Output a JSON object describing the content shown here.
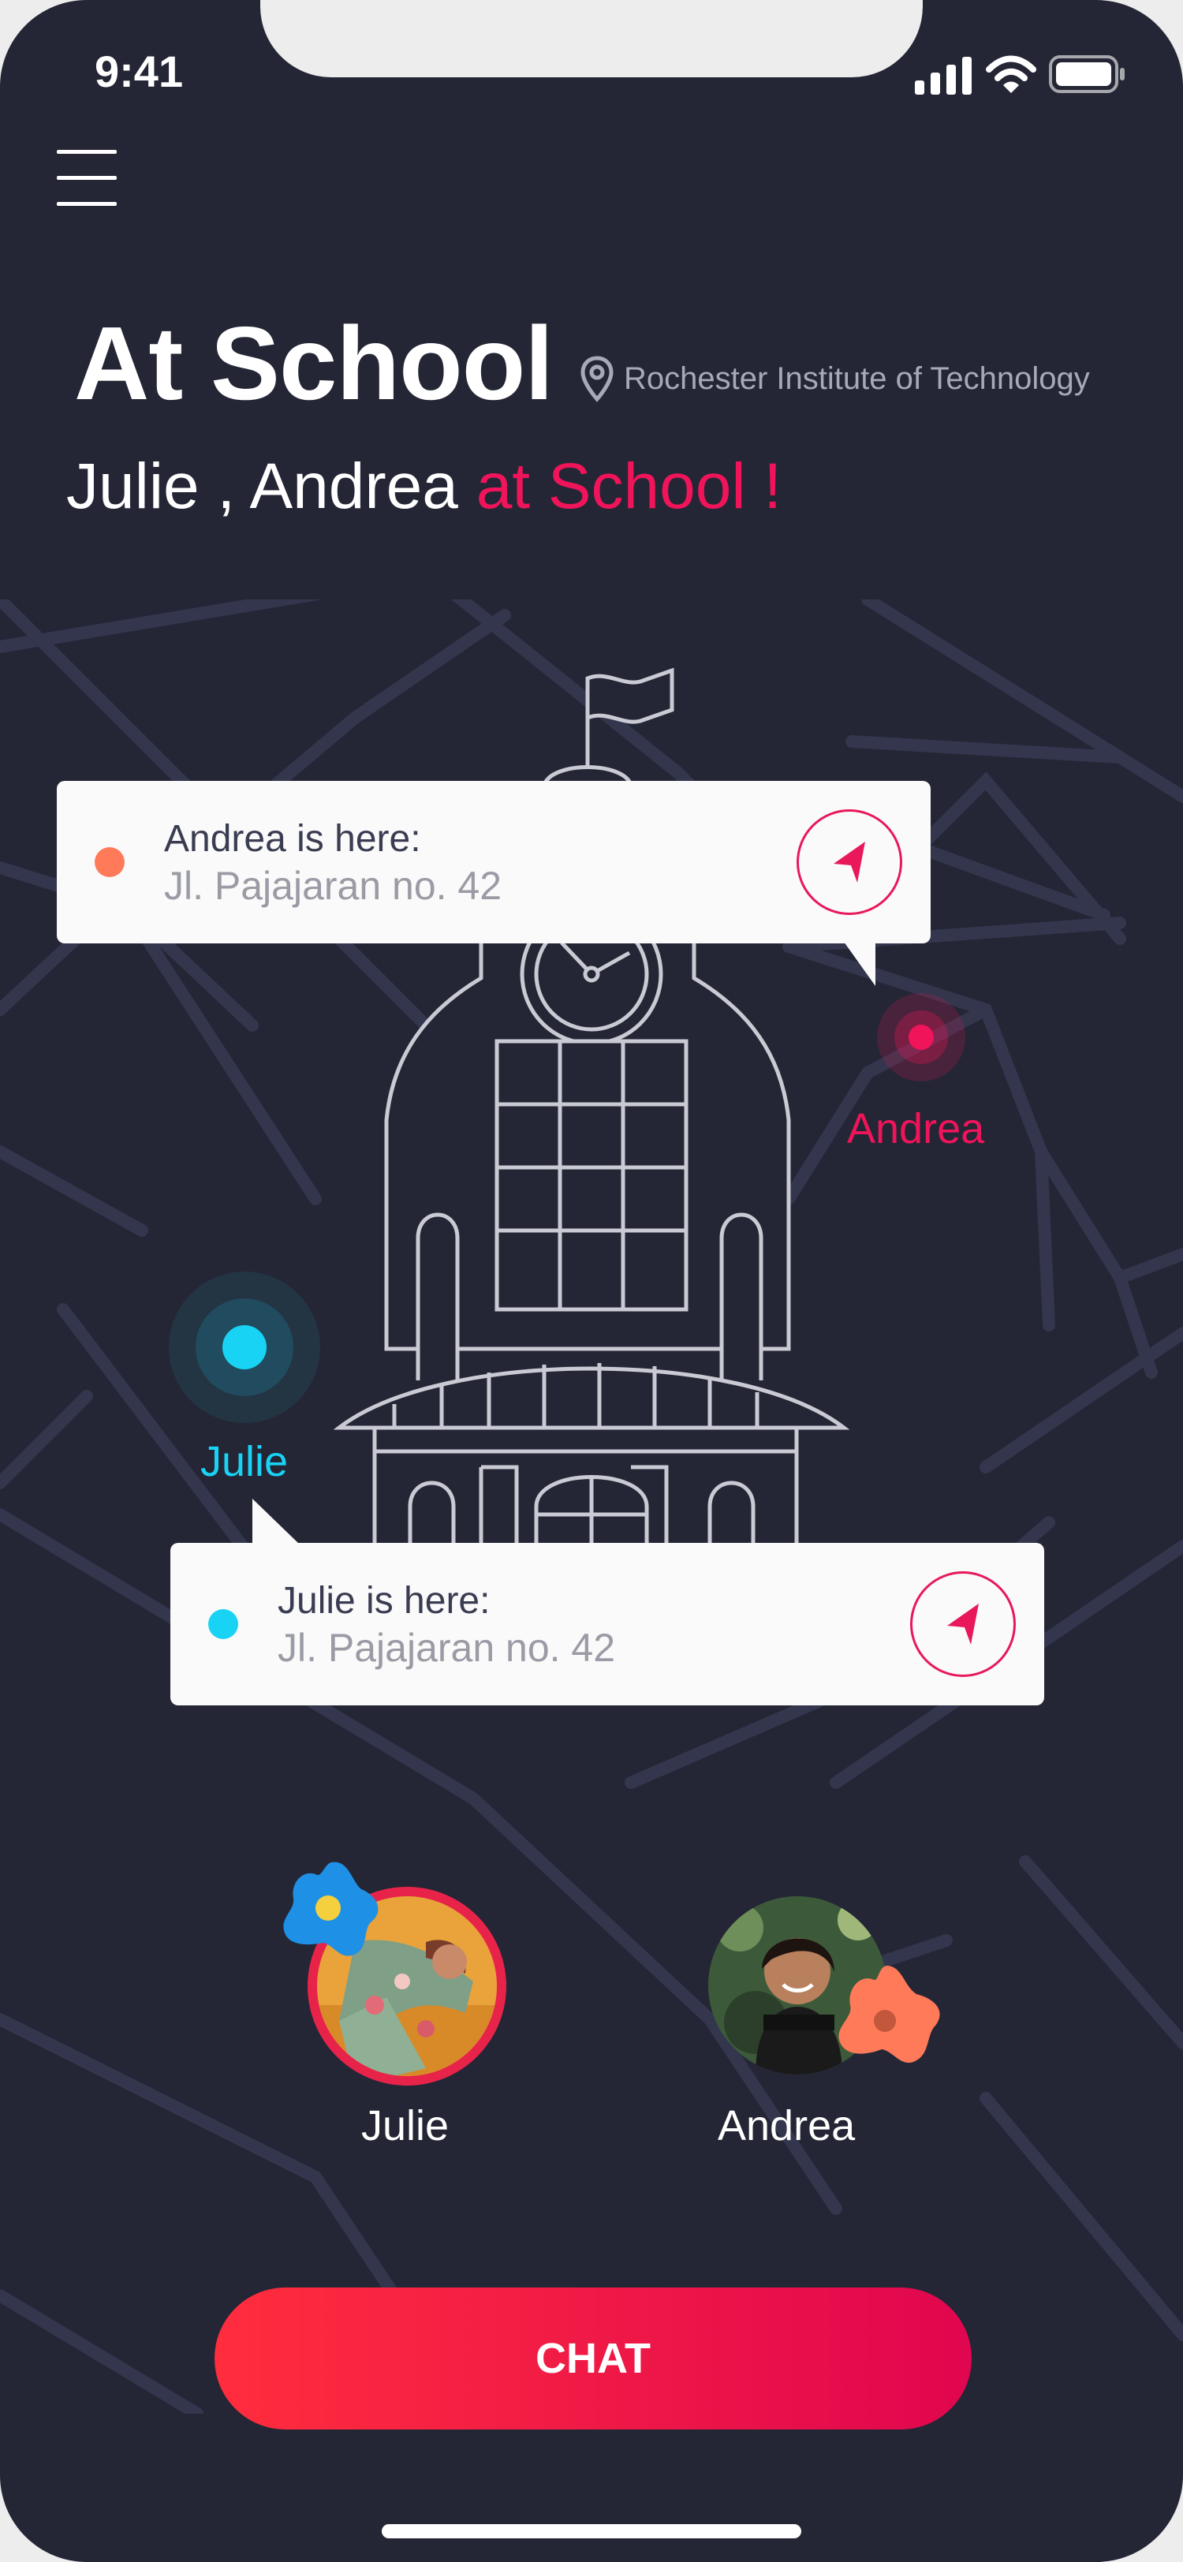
{
  "status_bar": {
    "time": "9:41"
  },
  "header": {
    "title": "At School",
    "location": "Rochester Institute of Technology",
    "subtitle_names": "Julie , Andrea",
    "subtitle_accent": "at School !"
  },
  "map": {
    "markers": [
      {
        "name": "Andrea",
        "color": "#f0145a"
      },
      {
        "name": "Julie",
        "color": "#19d3f5"
      }
    ],
    "callouts": [
      {
        "title": "Andrea is here:",
        "address": "Jl. Pajajaran no. 42",
        "dot_color": "#ff7a59"
      },
      {
        "title": "Julie is here:",
        "address": "Jl. Pajajaran no. 42",
        "dot_color": "#19d3f5"
      }
    ]
  },
  "friends": [
    {
      "name": "Julie"
    },
    {
      "name": "Andrea"
    }
  ],
  "actions": {
    "chat_label": "CHAT"
  },
  "colors": {
    "background": "#242635",
    "accent": "#f0145a",
    "julie": "#19d3f5",
    "andrea": "#ff7a59"
  },
  "icons": [
    "menu-icon",
    "signal-icon",
    "wifi-icon",
    "battery-icon",
    "location-pin-icon",
    "navigate-arrow-icon",
    "blob-badge-icon"
  ]
}
